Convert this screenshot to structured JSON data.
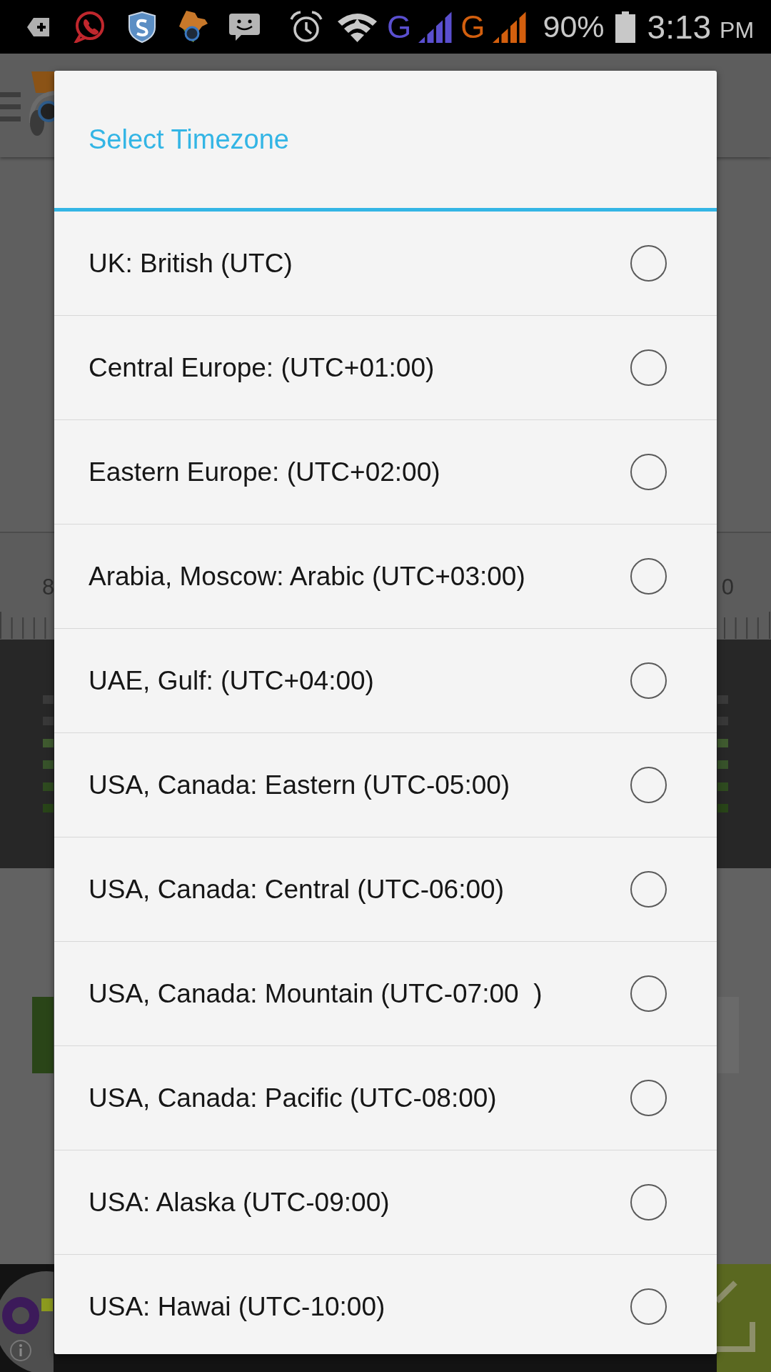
{
  "status_bar": {
    "networks": [
      {
        "type": "G",
        "color": "#5a4fcf"
      },
      {
        "type": "G",
        "color": "#d35f0e"
      }
    ],
    "battery": "90%",
    "time": "3:13",
    "period": "PM"
  },
  "background": {
    "ruler_labels": [
      "8",
      "0"
    ]
  },
  "dialog": {
    "title": "Select Timezone",
    "options": [
      {
        "label": "UK: British (UTC)",
        "selected": false
      },
      {
        "label": "Central Europe: (UTC+01:00)",
        "selected": false
      },
      {
        "label": "Eastern Europe: (UTC+02:00)",
        "selected": false
      },
      {
        "label": "Arabia, Moscow: Arabic (UTC+03:00)",
        "selected": false
      },
      {
        "label": "UAE, Gulf: (UTC+04:00)",
        "selected": false
      },
      {
        "label": "USA, Canada: Eastern (UTC-05:00)",
        "selected": false
      },
      {
        "label": "USA, Canada: Central (UTC-06:00)",
        "selected": false
      },
      {
        "label": "USA, Canada: Mountain (UTC-07:00  )",
        "selected": false
      },
      {
        "label": "USA, Canada: Pacific (UTC-08:00)",
        "selected": false
      },
      {
        "label": "USA: Alaska (UTC-09:00)",
        "selected": false
      },
      {
        "label": "USA: Hawai (UTC-10:00)",
        "selected": false
      }
    ]
  }
}
